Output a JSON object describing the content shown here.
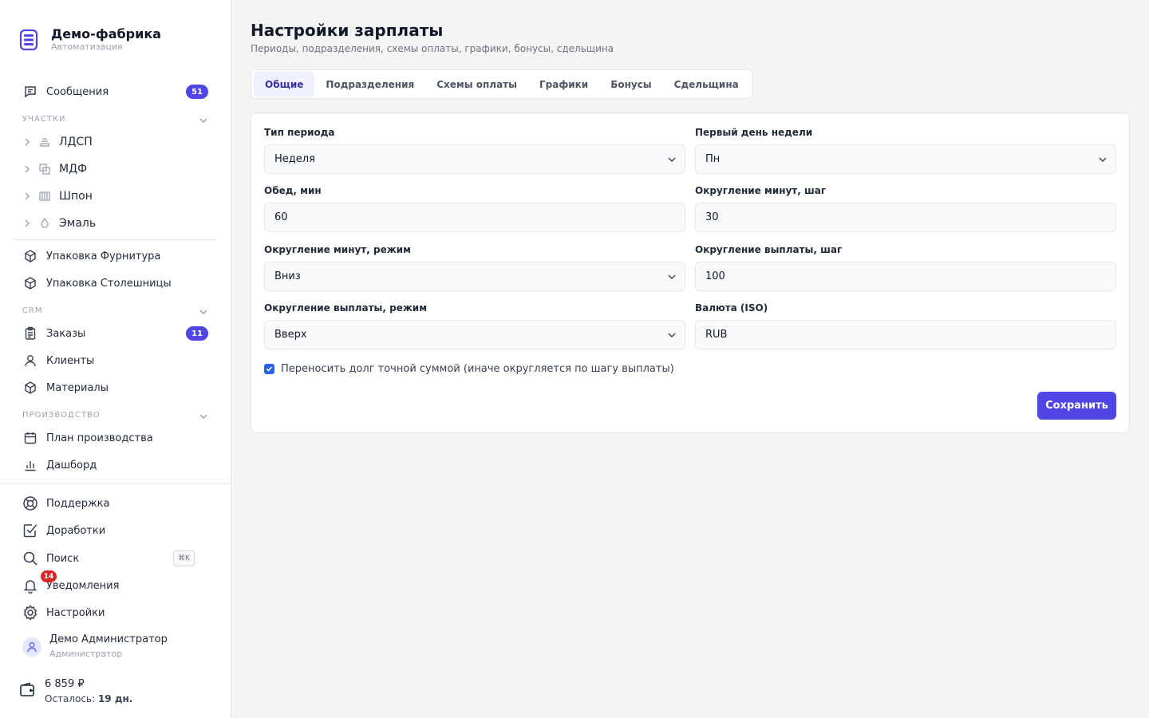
{
  "brand": {
    "title": "Демо-фабрика",
    "subtitle": "Автоматизация"
  },
  "sidebar": {
    "messages": {
      "label": "Сообщения",
      "badge": "51"
    },
    "section_areas": "УЧАСТКИ",
    "areas": [
      {
        "label": "ЛДСП",
        "icon": "layers-icon"
      },
      {
        "label": "МДФ",
        "icon": "squares-icon"
      },
      {
        "label": "Шпон",
        "icon": "columns-icon"
      },
      {
        "label": "Эмаль",
        "icon": "droplet-icon"
      }
    ],
    "packaging": [
      {
        "label": "Упаковка Фурнитура",
        "icon": "box-icon"
      },
      {
        "label": "Упаковка Столешницы",
        "icon": "box-icon"
      }
    ],
    "section_crm": "CRM",
    "crm": [
      {
        "label": "Заказы",
        "icon": "clipboard-icon",
        "badge": "11"
      },
      {
        "label": "Клиенты",
        "icon": "user-icon"
      },
      {
        "label": "Материалы",
        "icon": "cube-icon"
      }
    ],
    "section_production": "ПРОИЗВОДСТВО",
    "production": [
      {
        "label": "План производства",
        "icon": "calendar-icon"
      },
      {
        "label": "Дашборд",
        "icon": "bar-chart-icon"
      }
    ],
    "bottom": {
      "support": "Поддержка",
      "improvements": "Доработки",
      "search": "Поиск",
      "search_shortcut": "⌘K",
      "notifications": "Уведомления",
      "notifications_badge": "14",
      "settings": "Настройки"
    },
    "user": {
      "name": "Демо Администратор",
      "role": "Администратор"
    },
    "balance": {
      "amount": "6 859 ₽",
      "left_prefix": "Осталось:",
      "left_value": "19 дн."
    }
  },
  "main": {
    "title": "Настройки зарплаты",
    "subtitle": "Периоды, подразделения, схемы оплаты, графики, бонусы, сдельщина",
    "tabs": [
      {
        "label": "Общие",
        "active": true
      },
      {
        "label": "Подразделения"
      },
      {
        "label": "Схемы оплаты"
      },
      {
        "label": "Графики"
      },
      {
        "label": "Бонусы"
      },
      {
        "label": "Сдельщина"
      }
    ],
    "form": {
      "period_type": {
        "label": "Тип периода",
        "value": "Неделя"
      },
      "first_weekday": {
        "label": "Первый день недели",
        "value": "Пн"
      },
      "lunch": {
        "label": "Обед, мин",
        "value": "60"
      },
      "round_minutes_step": {
        "label": "Округление минут, шаг",
        "value": "30"
      },
      "round_minutes_mode": {
        "label": "Округление минут, режим",
        "value": "Вниз"
      },
      "round_pay_step": {
        "label": "Округление выплаты, шаг",
        "value": "100"
      },
      "round_pay_mode": {
        "label": "Округление выплаты, режим",
        "value": "Вверх"
      },
      "currency": {
        "label": "Валюта (ISO)",
        "value": "RUB"
      },
      "carry_debt": {
        "label": "Переносить долг точной суммой (иначе округляется по шагу выплаты)",
        "checked": true
      },
      "save": "Сохранить"
    }
  },
  "colors": {
    "accent": "#4f46e5",
    "danger": "#dc2626",
    "checkbox": "#2563eb"
  }
}
